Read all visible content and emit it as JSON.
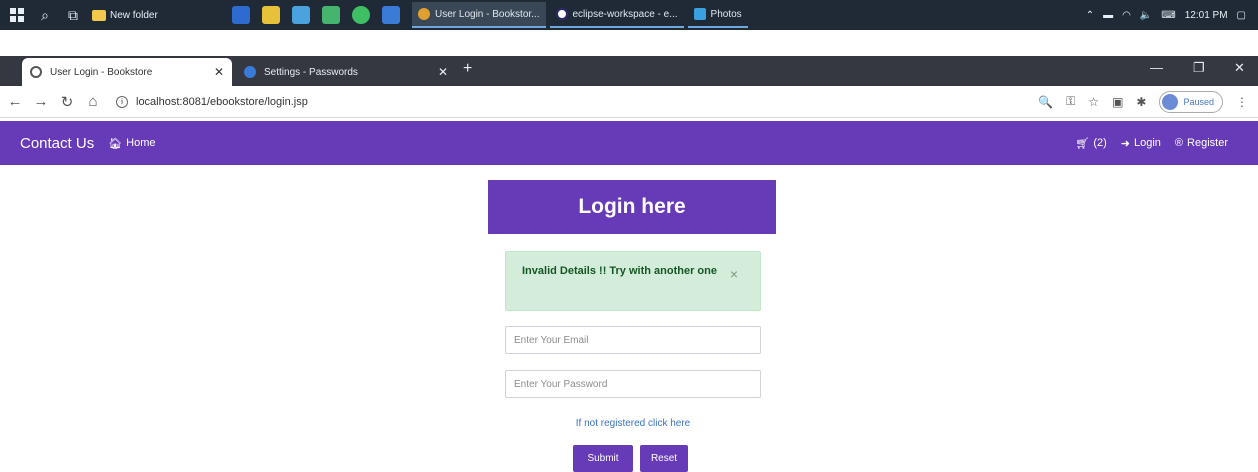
{
  "taskbar": {
    "folder_label": "New folder",
    "tasks": [
      "User Login - Bookstor...",
      "eclipse-workspace - e...",
      "Photos"
    ],
    "time": "12:01 PM"
  },
  "browser": {
    "tabs": [
      {
        "label": "User Login - Bookstore",
        "close": "✕"
      },
      {
        "label": "Settings - Passwords",
        "close": "✕"
      }
    ],
    "new_tab": "+",
    "url": "localhost:8081/ebookstore/login.jsp",
    "profile_status": "Paused"
  },
  "navbar": {
    "brand": "Contact Us",
    "home": "Home",
    "cart": "(2)",
    "login": "Login",
    "register": "Register"
  },
  "login": {
    "title": "Login here",
    "alert_text": "Invalid Details !! Try with another one",
    "alert_close": "×",
    "email_placeholder": "Enter Your Email",
    "password_placeholder": "Enter Your Password",
    "register_link": "If not registered click here",
    "submit_label": "Submit",
    "reset_label": "Reset"
  },
  "colors": {
    "primary": "#673ab7",
    "alert_bg": "#d4edda",
    "alert_text": "#155724",
    "link": "#3a73c9"
  }
}
